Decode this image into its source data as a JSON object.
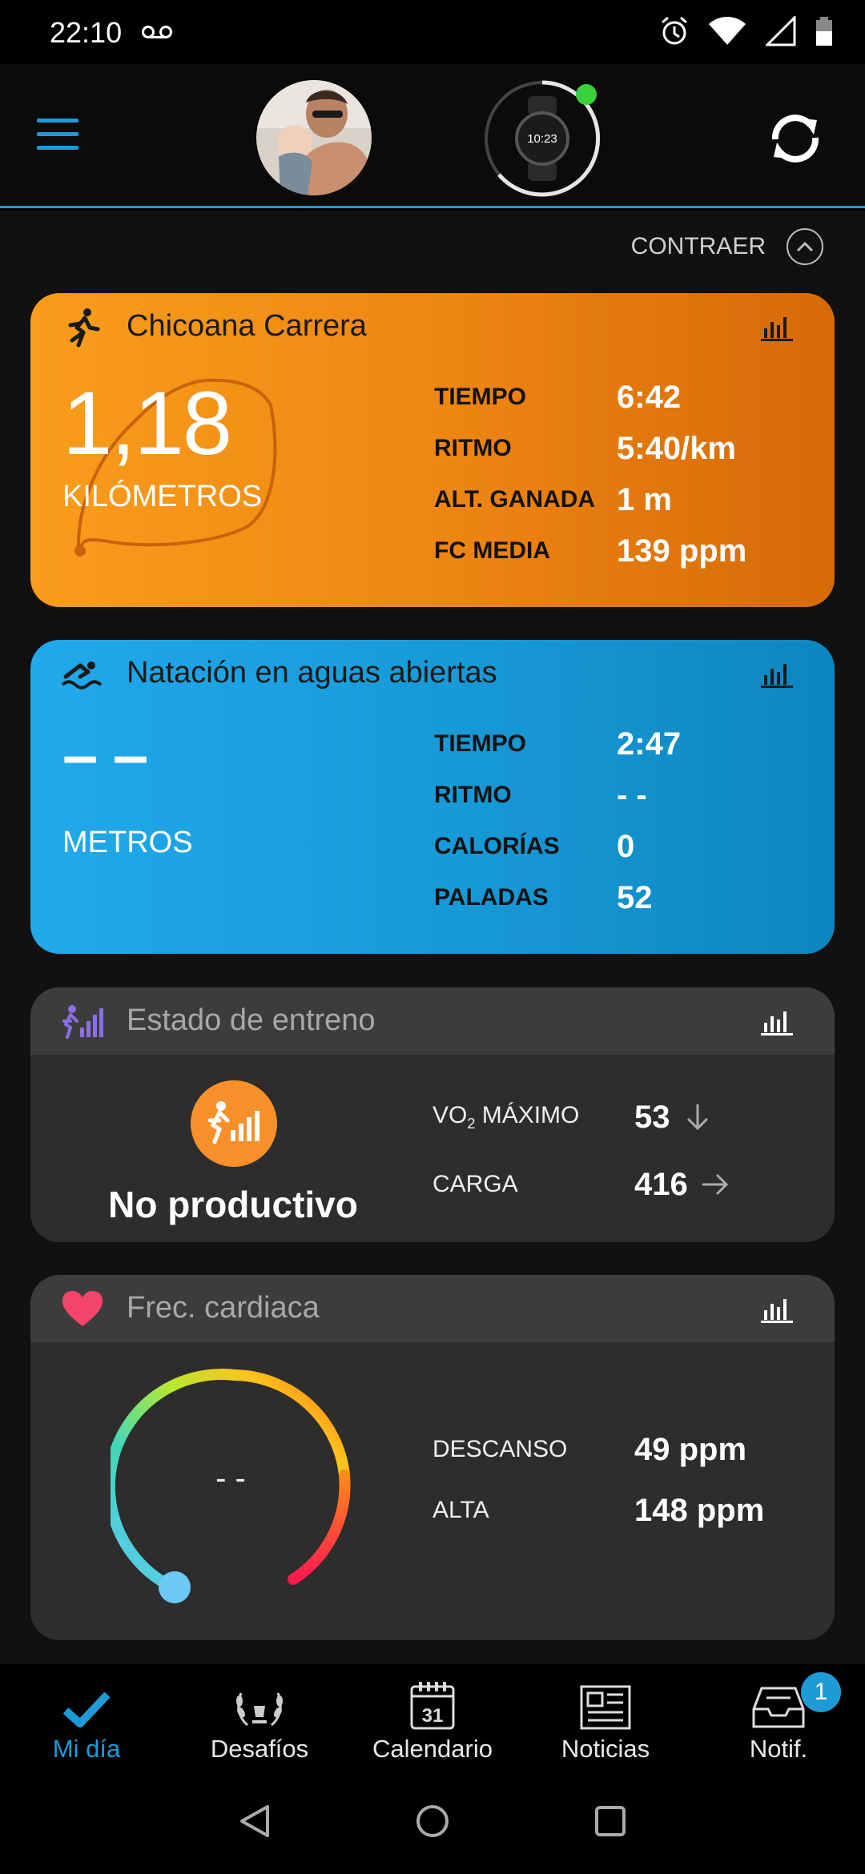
{
  "status": {
    "time": "22:10"
  },
  "header": {
    "collapse_label": "CONTRAER",
    "watch_time": "10:23"
  },
  "run": {
    "title": "Chicoana Carrera",
    "distance": "1,18",
    "unit": "KILÓMETROS",
    "stats": [
      {
        "label": "TIEMPO",
        "value": "6:42"
      },
      {
        "label": "RITMO",
        "value": "5:40/km"
      },
      {
        "label": "ALT. GANADA",
        "value": "1 m"
      },
      {
        "label": "FC MEDIA",
        "value": "139 ppm"
      }
    ]
  },
  "swim": {
    "title": "Natación en aguas abiertas",
    "distance": "– –",
    "unit": "METROS",
    "stats": [
      {
        "label": "TIEMPO",
        "value": "2:47"
      },
      {
        "label": "RITMO",
        "value": "- -"
      },
      {
        "label": "CALORÍAS",
        "value": "0"
      },
      {
        "label": "PALADAS",
        "value": "52"
      }
    ]
  },
  "training": {
    "title": "Estado de entreno",
    "status": "No productivo",
    "vo2_label_pre": "VO",
    "vo2_label_sub": "2",
    "vo2_label_post": " MÁXIMO",
    "vo2_value": "53",
    "vo2_trend": "down-arrow-icon",
    "load_label": "CARGA",
    "load_value": "416",
    "load_trend": "right-arrow-icon"
  },
  "heart": {
    "title": "Frec. cardiaca",
    "current": "- -",
    "stats": [
      {
        "label": "DESCANSO",
        "value": "49 ppm"
      },
      {
        "label": "ALTA",
        "value": "148 ppm"
      }
    ]
  },
  "nav": {
    "items": [
      {
        "label": "Mi día",
        "icon": "check-icon"
      },
      {
        "label": "Desafíos",
        "icon": "laurel-icon"
      },
      {
        "label": "Calendario",
        "icon": "calendar-icon",
        "day": "31"
      },
      {
        "label": "Noticias",
        "icon": "newspaper-icon"
      },
      {
        "label": "Notif.",
        "icon": "inbox-icon",
        "badge": "1"
      }
    ]
  },
  "colors": {
    "accent": "#1e9bd7",
    "run": "#ef8713",
    "swim": "#1799d6",
    "card": "#2d2d2d"
  }
}
